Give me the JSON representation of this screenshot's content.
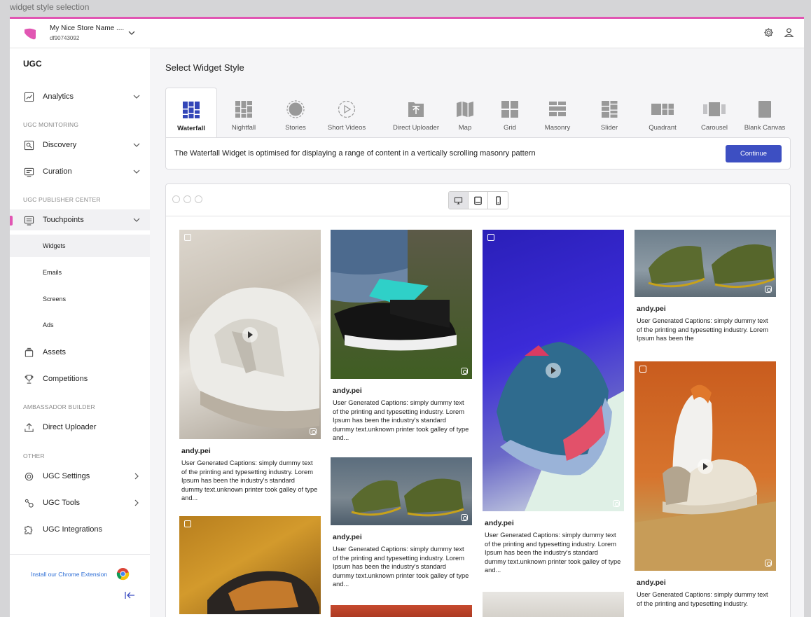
{
  "frame_label": "widget style selection",
  "header": {
    "store_name": "My Nice Store Name ....",
    "store_id": "df90743092"
  },
  "sidebar": {
    "title": "UGC",
    "analytics": "Analytics",
    "sec_monitoring": "UGC MONITORING",
    "discovery": "Discovery",
    "curation": "Curation",
    "sec_publisher": "UGC PUBLISHER CENTER",
    "touchpoints": "Touchpoints",
    "widgets": "Widgets",
    "emails": "Emails",
    "screens": "Screens",
    "ads": "Ads",
    "assets": "Assets",
    "competitions": "Competitions",
    "sec_ambassador": "AMBASSADOR BUILDER",
    "direct_uploader": "Direct Uploader",
    "sec_other": "OTHER",
    "ugc_settings": "UGC Settings",
    "ugc_tools": "UGC Tools",
    "ugc_integrations": "UGC Integrations",
    "chrome_extension": "Install our Chrome Extension"
  },
  "main": {
    "title": "Select Widget Style",
    "styles": [
      "Waterfall",
      "Nightfall",
      "Stories",
      "Short Videos",
      "Direct Uploader",
      "Map",
      "Grid",
      "Masonry",
      "Slider",
      "Quadrant",
      "Carousel",
      "Blank Canvas"
    ],
    "selected_style": "Waterfall",
    "description": "The Waterfall Widget is optimised for displaying a range of content in a vertically scrolling masonry pattern",
    "continue_label": "Continue"
  },
  "preview": {
    "device_selected": "desktop",
    "cards": [
      {
        "user": "andy.pei",
        "caption": "User Generated Captions: simply dummy text of the printing and typesetting industry. Lorem Ipsum has been the industry's standard dummy text.unknown printer took galley of type and..."
      },
      {
        "user": "andy.pei",
        "caption": "User Generated Captions: simply dummy text of the printing and typesetting industry. Lorem Ipsum has been the industry's standard dummy text.unknown printer took galley of type and..."
      },
      {
        "user": "andy.pei",
        "caption": "User Generated Captions: simply dummy text of the printing and typesetting industry. Lorem Ipsum has been the industry's standard dummy text.unknown printer took galley of type and..."
      },
      {
        "user": "andy.pei",
        "caption": "User Generated Captions: simply dummy text of the printing and typesetting industry. Lorem Ipsum has been the industry's standard dummy text.unknown printer took galley of type and..."
      },
      {
        "user": "andy.pei",
        "caption": "User Generated Captions: simply dummy text of the printing and typesetting industry. Lorem Ipsum has been the"
      },
      {
        "user": "andy.pei",
        "caption": "User Generated Captions: simply dummy text of the printing and typesetting industry."
      }
    ]
  },
  "colors": {
    "accent": "#e156b3",
    "primary_button": "#3d4fc2",
    "active_icon": "#3346b8"
  }
}
